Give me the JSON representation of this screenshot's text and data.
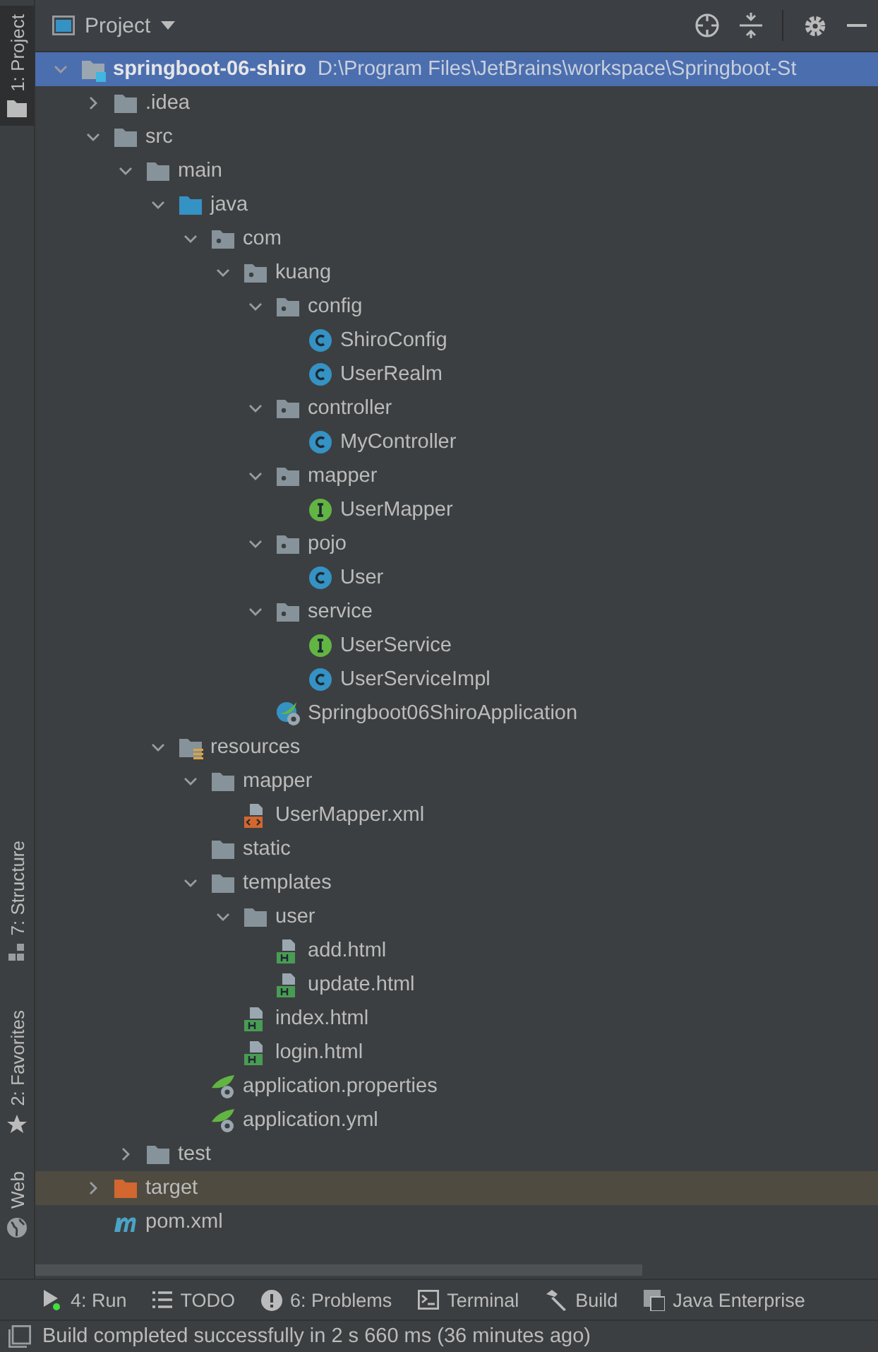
{
  "side_tabs": [
    {
      "label": "1: Project",
      "kind": "folder",
      "selected": true
    },
    {
      "label": "7: Structure",
      "kind": "structure",
      "selected": false
    },
    {
      "label": "2: Favorites",
      "kind": "star",
      "selected": false
    },
    {
      "label": "Web",
      "kind": "globe",
      "selected": false
    }
  ],
  "panel": {
    "title": "Project"
  },
  "tree": [
    {
      "kind": "module",
      "name": "springboot-06-shiro",
      "path": "D:\\Program Files\\JetBrains\\workspace\\Springboot-St",
      "selected": true,
      "expanded": true,
      "children": [
        {
          "kind": "folder",
          "name": ".idea",
          "selected": false,
          "expanded": false
        },
        {
          "kind": "folder",
          "name": "src",
          "selected": false,
          "expanded": true,
          "children": [
            {
              "kind": "folder",
              "name": "main",
              "selected": false,
              "expanded": true,
              "children": [
                {
                  "kind": "source",
                  "name": "java",
                  "selected": false,
                  "expanded": true,
                  "children": [
                    {
                      "kind": "package",
                      "name": "com",
                      "selected": false,
                      "expanded": true,
                      "children": [
                        {
                          "kind": "package",
                          "name": "kuang",
                          "selected": false,
                          "expanded": true,
                          "children": [
                            {
                              "kind": "package",
                              "name": "config",
                              "selected": false,
                              "expanded": true,
                              "children": [
                                {
                                  "kind": "class",
                                  "name": "ShiroConfig",
                                  "selected": false
                                },
                                {
                                  "kind": "class",
                                  "name": "UserRealm",
                                  "selected": false
                                }
                              ]
                            },
                            {
                              "kind": "package",
                              "name": "controller",
                              "selected": false,
                              "expanded": true,
                              "children": [
                                {
                                  "kind": "class",
                                  "name": "MyController",
                                  "selected": false
                                }
                              ]
                            },
                            {
                              "kind": "package",
                              "name": "mapper",
                              "selected": false,
                              "expanded": true,
                              "children": [
                                {
                                  "kind": "interface",
                                  "name": "UserMapper",
                                  "selected": false
                                }
                              ]
                            },
                            {
                              "kind": "package",
                              "name": "pojo",
                              "selected": false,
                              "expanded": true,
                              "children": [
                                {
                                  "kind": "class",
                                  "name": "User",
                                  "selected": false
                                }
                              ]
                            },
                            {
                              "kind": "package",
                              "name": "service",
                              "selected": false,
                              "expanded": true,
                              "children": [
                                {
                                  "kind": "interface",
                                  "name": "UserService",
                                  "selected": false
                                },
                                {
                                  "kind": "class",
                                  "name": "UserServiceImpl",
                                  "selected": false
                                }
                              ]
                            },
                            {
                              "kind": "app",
                              "name": "Springboot06ShiroApplication",
                              "selected": false
                            }
                          ]
                        }
                      ]
                    }
                  ]
                },
                {
                  "kind": "resources",
                  "name": "resources",
                  "selected": false,
                  "expanded": true,
                  "children": [
                    {
                      "kind": "folder",
                      "name": "mapper",
                      "selected": false,
                      "expanded": true,
                      "children": [
                        {
                          "kind": "xml",
                          "name": "UserMapper.xml",
                          "selected": false
                        }
                      ]
                    },
                    {
                      "kind": "folder",
                      "name": "static",
                      "selected": false
                    },
                    {
                      "kind": "folder",
                      "name": "templates",
                      "selected": false,
                      "expanded": true,
                      "children": [
                        {
                          "kind": "folder",
                          "name": "user",
                          "selected": false,
                          "expanded": true,
                          "children": [
                            {
                              "kind": "html",
                              "name": "add.html",
                              "selected": false
                            },
                            {
                              "kind": "html",
                              "name": "update.html",
                              "selected": false
                            }
                          ]
                        },
                        {
                          "kind": "html",
                          "name": "index.html",
                          "selected": false
                        },
                        {
                          "kind": "html",
                          "name": "login.html",
                          "selected": false
                        }
                      ]
                    },
                    {
                      "kind": "spring",
                      "name": "application.properties",
                      "selected": false
                    },
                    {
                      "kind": "spring",
                      "name": "application.yml",
                      "selected": false
                    }
                  ]
                }
              ]
            },
            {
              "kind": "folder",
              "name": "test",
              "selected": false,
              "expanded": false
            }
          ]
        },
        {
          "kind": "excluded",
          "name": "target",
          "selected": false,
          "expanded": false
        },
        {
          "kind": "maven",
          "name": "pom.xml",
          "selected": false
        }
      ]
    }
  ],
  "tool_windows": [
    {
      "label": "4: Run",
      "kind": "run"
    },
    {
      "label": "TODO",
      "kind": "list"
    },
    {
      "label": "6: Problems",
      "kind": "alert"
    },
    {
      "label": "Terminal",
      "kind": "terminal"
    },
    {
      "label": "Build",
      "kind": "hammer"
    },
    {
      "label": "Java Enterprise",
      "kind": "enterprise"
    }
  ],
  "status": "Build completed successfully in 2 s 660 ms (36 minutes ago)"
}
